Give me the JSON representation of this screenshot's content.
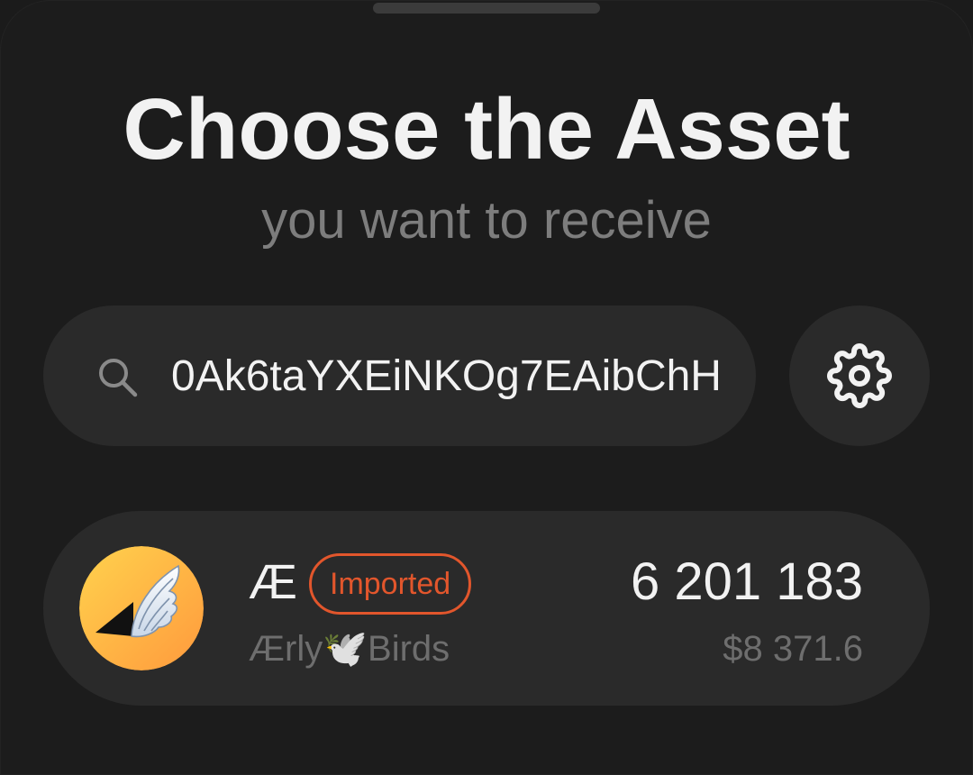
{
  "header": {
    "title": "Choose the Asset",
    "subtitle": "you want to receive"
  },
  "search": {
    "value": "0Ak6taYXEiNKOg7EAibChH",
    "icon": "search-icon"
  },
  "settings": {
    "icon": "gear-icon"
  },
  "assets": [
    {
      "symbol": "Æ",
      "badge": "Imported",
      "name": "Ærly🕊️Birds",
      "balance": "6 201 183",
      "fiat": "$8 371.6",
      "icon": "wing-icon"
    }
  ],
  "colors": {
    "background": "#1c1c1c",
    "surface": "#2a2a2a",
    "text_primary": "#f2f2f2",
    "text_secondary": "#6e6e6e",
    "accent_badge": "#e2562c",
    "avatar_gradient_start": "#ffd24d",
    "avatar_gradient_end": "#ff9a3d"
  }
}
